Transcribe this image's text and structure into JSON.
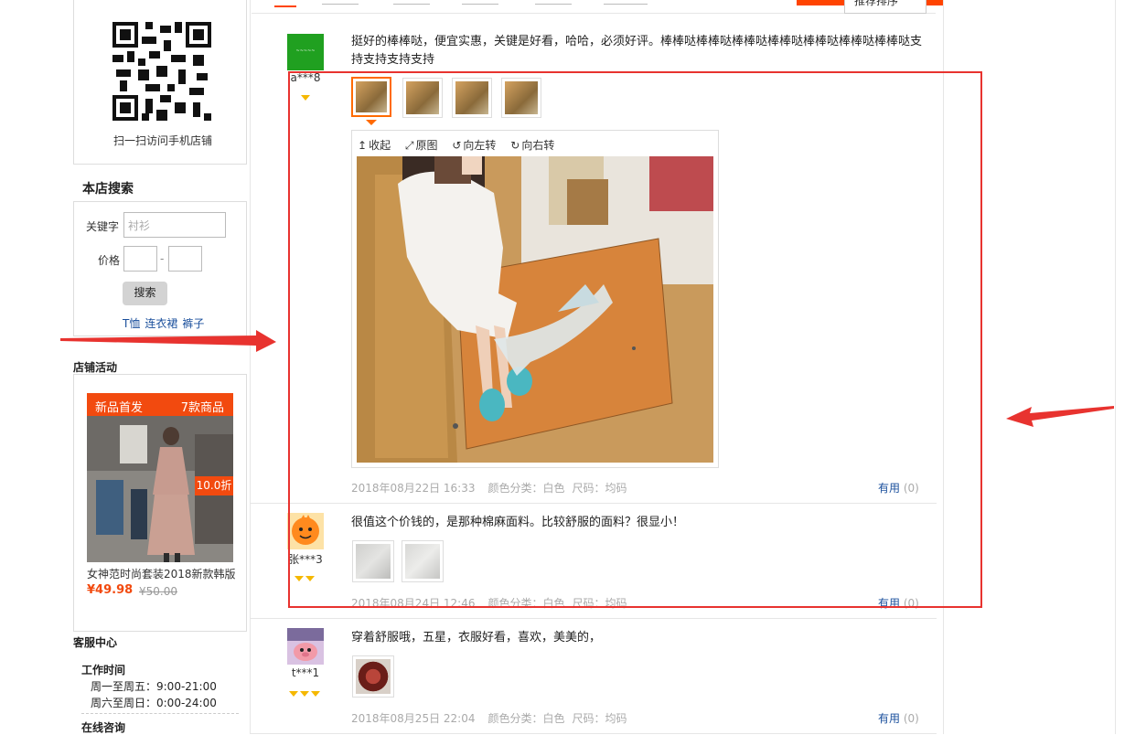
{
  "sidebar": {
    "qr_caption": "扫一扫访问手机店铺",
    "search": {
      "title": "本店搜索",
      "keyword_label": "关键字",
      "keyword_placeholder": "衬衫",
      "price_label": "价格",
      "price_sep": "-",
      "button": "搜索",
      "links": [
        "T恤",
        "连衣裙",
        "裤子"
      ]
    },
    "promo": {
      "title": "店铺活动",
      "banner_left": "新品首发",
      "banner_right": "7款商品",
      "discount": "10.0折",
      "product_name": "女神范时尚套装2018新款韩版",
      "price": "¥49.98",
      "old_price": "¥50.00"
    },
    "service": {
      "title": "客服中心",
      "hours_title": "工作时间",
      "weekday": "周一至周五：9:00-21:00",
      "weekend": "周六至周日：0:00-24:00",
      "consult_title": "在线咨询"
    }
  },
  "tabs": {
    "sort_button": "推荐排序"
  },
  "reviews": [
    {
      "user": "a***8",
      "text": "挺好的棒棒哒，便宜实惠，关键是好看，哈哈，必须好评。棒棒哒棒棒哒棒棒哒棒棒哒棒棒哒棒棒哒棒棒哒支持支持支持支持",
      "date": "2018年08月22日 16:33",
      "color": "颜色分类：白色",
      "size": "尺码：均码",
      "useful_label": "有用",
      "useful_count": "(0)",
      "viewer": {
        "collapse": "收起",
        "original": "原图",
        "rotate_left": "向左转",
        "rotate_right": "向右转"
      }
    },
    {
      "user": "张***3",
      "text": "很值这个价钱的，是那种棉麻面料。比较舒服的面料？很显小！",
      "date": "2018年08月24日 12:46",
      "color": "颜色分类：白色",
      "size": "尺码：均码",
      "useful_label": "有用",
      "useful_count": "(0)"
    },
    {
      "user": "t***1",
      "text": "穿着舒服哦，五星，衣服好看，喜欢，美美的，",
      "date": "2018年08月25日 22:04",
      "color": "颜色分类：白色",
      "size": "尺码：均码",
      "useful_label": "有用",
      "useful_count": "(0)"
    }
  ],
  "colors": {
    "accent": "#ff4400",
    "annotation_red": "#e8332f",
    "link": "#1a4f9c"
  }
}
